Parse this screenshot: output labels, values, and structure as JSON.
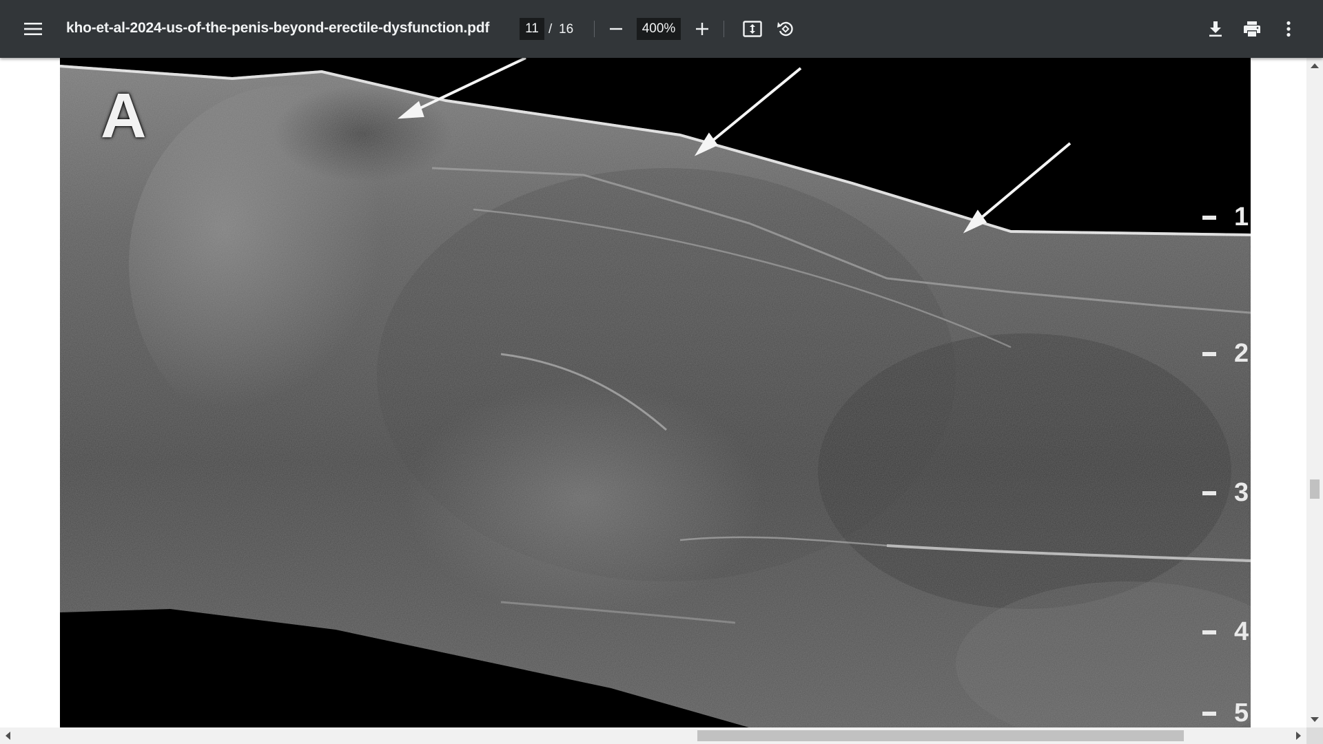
{
  "toolbar": {
    "title": "kho-et-al-2024-us-of-the-penis-beyond-erectile-dysfunction.pdf",
    "current_page": "11",
    "page_separator": "/",
    "total_pages": "16",
    "zoom_level": "400%",
    "icons": {
      "menu": "menu-icon",
      "zoom_out": "minus-icon",
      "zoom_in": "plus-icon",
      "fit": "fit-to-page-icon",
      "rotate": "rotate-counterclockwise-icon",
      "download": "download-icon",
      "print": "print-icon",
      "more": "more-vertical-icon"
    },
    "background_color": "#323639"
  },
  "document": {
    "figure": {
      "panel_label": "A",
      "depth_scale": [
        "1",
        "2",
        "3",
        "4",
        "5"
      ]
    }
  }
}
